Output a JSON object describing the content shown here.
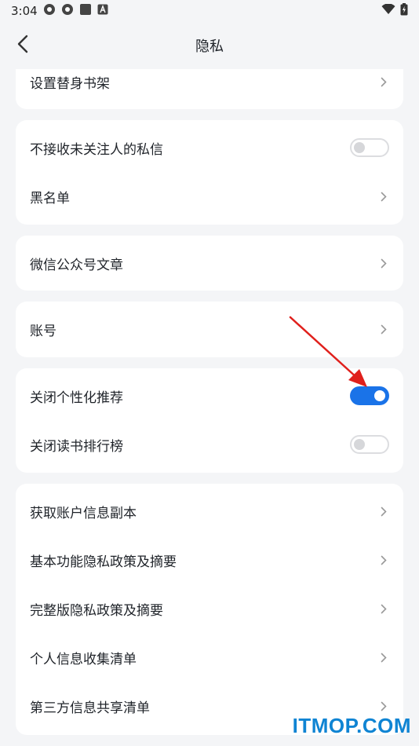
{
  "status_bar": {
    "time": "3:04",
    "icons": [
      "app-icon",
      "app-icon",
      "square-icon",
      "a-box-icon",
      "wifi-icon",
      "battery-icon"
    ]
  },
  "header": {
    "title": "隐私",
    "back_icon": "chevron-left-icon"
  },
  "cards": {
    "c0": {
      "items": [
        {
          "label": "设置替身书架",
          "control": "chevron"
        }
      ]
    },
    "c1": {
      "items": [
        {
          "label": "不接收未关注人的私信",
          "control": "toggle",
          "toggle_on": false
        },
        {
          "label": "黑名单",
          "control": "chevron"
        }
      ]
    },
    "c2": {
      "items": [
        {
          "label": "微信公众号文章",
          "control": "chevron"
        }
      ]
    },
    "c3": {
      "items": [
        {
          "label": "账号",
          "control": "chevron"
        }
      ]
    },
    "c4": {
      "items": [
        {
          "label": "关闭个性化推荐",
          "control": "toggle",
          "toggle_on": true
        },
        {
          "label": "关闭读书排行榜",
          "control": "toggle",
          "toggle_on": false
        }
      ]
    },
    "c5": {
      "items": [
        {
          "label": "获取账户信息副本",
          "control": "chevron"
        },
        {
          "label": "基本功能隐私政策及摘要",
          "control": "chevron"
        },
        {
          "label": "完整版隐私政策及摘要",
          "control": "chevron"
        },
        {
          "label": "个人信息收集清单",
          "control": "chevron"
        },
        {
          "label": "第三方信息共享清单",
          "control": "chevron"
        }
      ]
    }
  },
  "colors": {
    "accent": "#1a73e8",
    "annotation_arrow": "#e0201c",
    "watermark": "#0f84d3"
  },
  "watermark": "ITMOP.COM"
}
